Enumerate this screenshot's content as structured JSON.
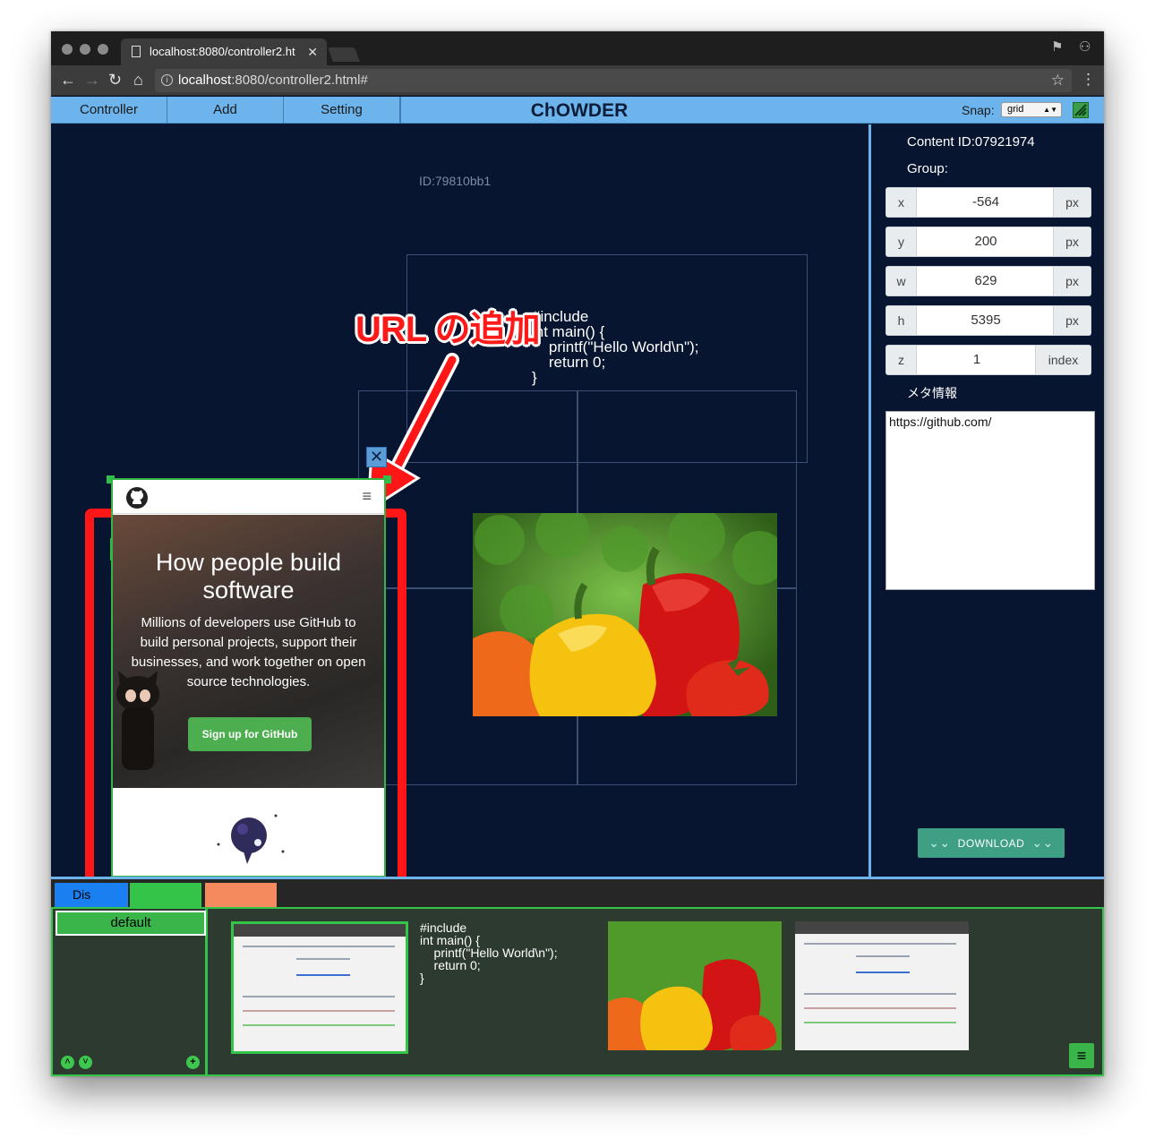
{
  "browser": {
    "tab_title": "localhost:8080/controller2.ht",
    "url_host": "localhost",
    "url_path": ":8080/controller2.html#"
  },
  "app": {
    "menu": [
      "Controller",
      "Add",
      "Setting"
    ],
    "title": "ChOWDER",
    "snap_label": "Snap:",
    "snap_value": "grid"
  },
  "canvas": {
    "display_id": "ID:79810bb1",
    "code_text": "#include\nint main() {\n    printf(\"Hello World\\n\");\n    return 0;\n}",
    "annotation": "URL の追加"
  },
  "github_page": {
    "headline": "How people build software",
    "body": "Millions of developers use GitHub to build personal projects, support their businesses, and work together on open source technologies.",
    "cta": "Sign up for GitHub"
  },
  "panel": {
    "content_id": "Content ID:07921974",
    "group_label": "Group:",
    "props": [
      {
        "key": "x",
        "value": "-564",
        "unit": "px"
      },
      {
        "key": "y",
        "value": "200",
        "unit": "px"
      },
      {
        "key": "w",
        "value": "629",
        "unit": "px"
      },
      {
        "key": "h",
        "value": "5395",
        "unit": "px"
      },
      {
        "key": "z",
        "value": "1",
        "unit": "index"
      }
    ],
    "meta_label": "メタ情報",
    "meta_value": "https://github.com/",
    "download": "DOWNLOAD"
  },
  "bottom": {
    "tab_display": "Dis",
    "group_default": "default",
    "thumb_code": "#include\nint main() {\n    printf(\"Hello World\\n\");\n    return 0;\n}"
  },
  "colors": {
    "accent": "#6db3ec",
    "group_green": "#3ab54a",
    "highlight_red": "#ff1717",
    "background": "#071531"
  }
}
